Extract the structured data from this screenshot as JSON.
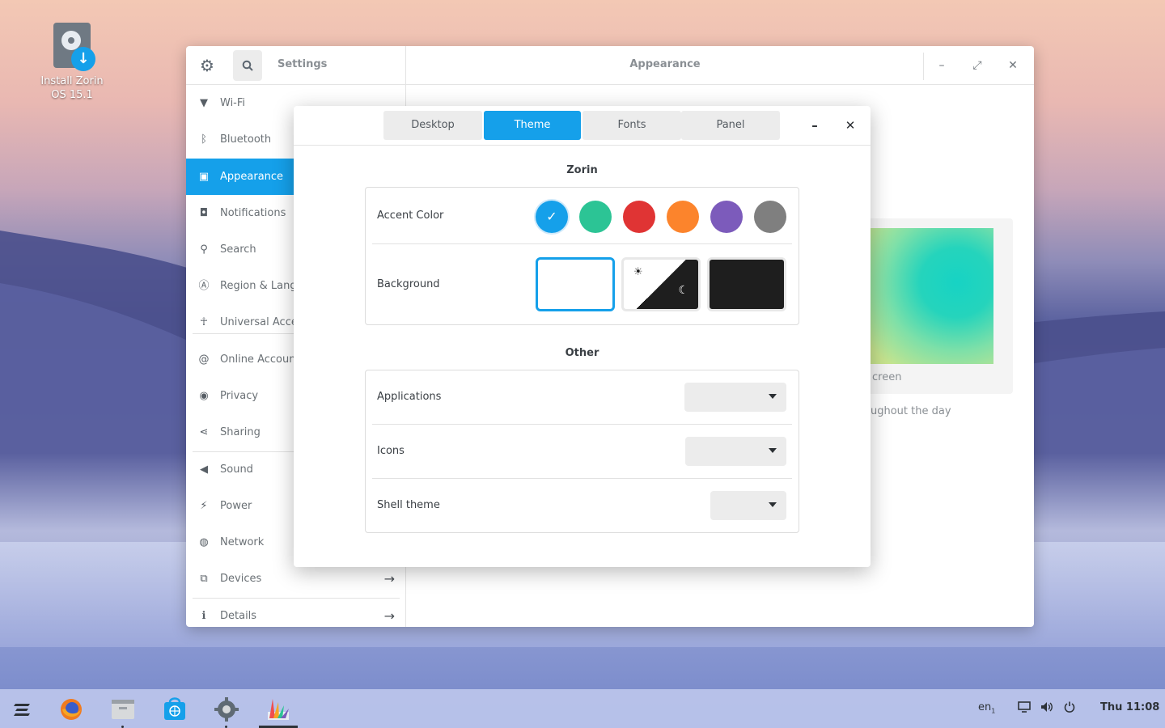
{
  "desktop": {
    "icon_label": "Install Zorin OS 15.1"
  },
  "settings_window": {
    "title": "Settings",
    "page_title": "Appearance",
    "sidebar": [
      {
        "label": "Wi-Fi",
        "icon": "wifi-icon"
      },
      {
        "label": "Bluetooth",
        "icon": "bluetooth-icon"
      },
      {
        "label": "Appearance",
        "icon": "appearance-icon",
        "active": true
      },
      {
        "label": "Notifications",
        "icon": "notifications-icon"
      },
      {
        "label": "Search",
        "icon": "search-icon"
      },
      {
        "label": "Region & Lang",
        "icon": "region-icon"
      },
      {
        "label": "Universal Acce",
        "icon": "accessibility-icon"
      },
      {
        "label": "Online Accoun",
        "icon": "online-accounts-icon"
      },
      {
        "label": "Privacy",
        "icon": "privacy-icon"
      },
      {
        "label": "Sharing",
        "icon": "sharing-icon"
      },
      {
        "label": "Sound",
        "icon": "sound-icon"
      },
      {
        "label": "Power",
        "icon": "power-icon"
      },
      {
        "label": "Network",
        "icon": "network-icon"
      },
      {
        "label": "Devices",
        "icon": "devices-icon"
      },
      {
        "label": "Details",
        "icon": "details-icon"
      }
    ],
    "preview_caption": "creen",
    "preview_sub": "ughout the day"
  },
  "tweaks_window": {
    "tabs": [
      "Desktop",
      "Theme",
      "Fonts",
      "Panel"
    ],
    "active_tab": "Theme",
    "zorin_section": {
      "title": "Zorin",
      "accent_label": "Accent Color",
      "accent_colors": [
        "#15a0ea",
        "#2cc495",
        "#e03434",
        "#fc842c",
        "#7c5bbb",
        "#7f7f7f"
      ],
      "selected_accent": "#15a0ea",
      "background_label": "Background",
      "background_options": [
        "light",
        "auto",
        "dark"
      ],
      "selected_background": "light"
    },
    "other_section": {
      "title": "Other",
      "rows": [
        {
          "label": "Applications",
          "value": ""
        },
        {
          "label": "Icons",
          "value": ""
        },
        {
          "label": "Shell theme",
          "value": ""
        }
      ]
    }
  },
  "taskbar": {
    "apps": [
      "zorin-menu-icon",
      "firefox-icon",
      "files-icon",
      "software-store-icon",
      "settings-icon",
      "tweaks-icon"
    ],
    "keyboard_layout": "en",
    "keyboard_sub": "1",
    "clock": "Thu 11:08"
  }
}
